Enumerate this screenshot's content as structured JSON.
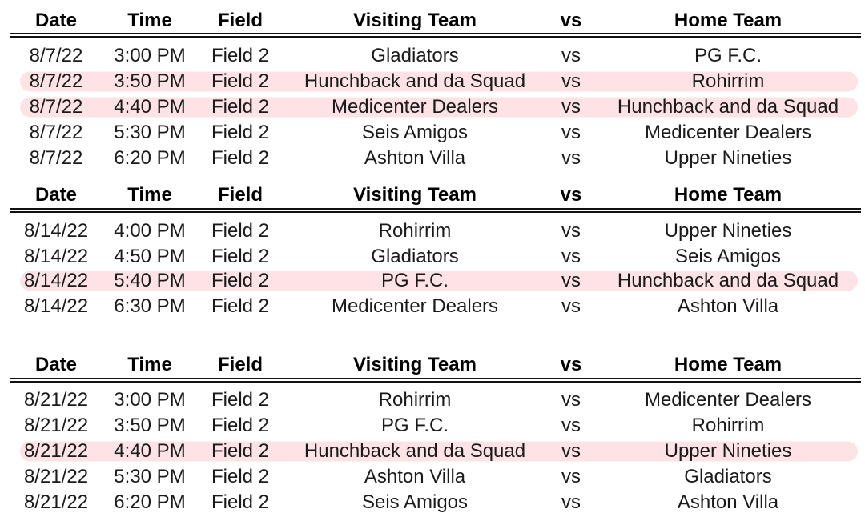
{
  "columns": [
    "Date",
    "Time",
    "Field",
    "Visiting Team",
    "vs",
    "Home Team"
  ],
  "highlight_color": "#fde3e5",
  "sections": [
    {
      "rows": [
        {
          "date": "8/7/22",
          "time": "3:00 PM",
          "field": "Field 2",
          "visiting": "Gladiators",
          "vs": "vs",
          "home": "PG F.C.",
          "highlighted": false
        },
        {
          "date": "8/7/22",
          "time": "3:50 PM",
          "field": "Field 2",
          "visiting": "Hunchback and da Squad",
          "vs": "vs",
          "home": "Rohirrim",
          "highlighted": true
        },
        {
          "date": "8/7/22",
          "time": "4:40 PM",
          "field": "Field 2",
          "visiting": "Medicenter Dealers",
          "vs": "vs",
          "home": "Hunchback and da Squad",
          "highlighted": true
        },
        {
          "date": "8/7/22",
          "time": "5:30 PM",
          "field": "Field 2",
          "visiting": "Seis Amigos",
          "vs": "vs",
          "home": "Medicenter Dealers",
          "highlighted": false
        },
        {
          "date": "8/7/22",
          "time": "6:20 PM",
          "field": "Field 2",
          "visiting": "Ashton Villa",
          "vs": "vs",
          "home": "Upper Nineties",
          "highlighted": false
        }
      ]
    },
    {
      "rows": [
        {
          "date": "8/14/22",
          "time": "4:00 PM",
          "field": "Field 2",
          "visiting": "Rohirrim",
          "vs": "vs",
          "home": "Upper Nineties",
          "highlighted": false
        },
        {
          "date": "8/14/22",
          "time": "4:50 PM",
          "field": "Field 2",
          "visiting": "Gladiators",
          "vs": "vs",
          "home": "Seis Amigos",
          "highlighted": false
        },
        {
          "date": "8/14/22",
          "time": "5:40 PM",
          "field": "Field 2",
          "visiting": "PG F.C.",
          "vs": "vs",
          "home": "Hunchback and da Squad",
          "highlighted": true
        },
        {
          "date": "8/14/22",
          "time": "6:30 PM",
          "field": "Field 2",
          "visiting": "Medicenter Dealers",
          "vs": "vs",
          "home": "Ashton Villa",
          "highlighted": false
        }
      ]
    },
    {
      "rows": [
        {
          "date": "8/21/22",
          "time": "3:00 PM",
          "field": "Field 2",
          "visiting": "Rohirrim",
          "vs": "vs",
          "home": "Medicenter Dealers",
          "highlighted": false
        },
        {
          "date": "8/21/22",
          "time": "3:50 PM",
          "field": "Field 2",
          "visiting": "PG F.C.",
          "vs": "vs",
          "home": "Rohirrim",
          "highlighted": false
        },
        {
          "date": "8/21/22",
          "time": "4:40 PM",
          "field": "Field 2",
          "visiting": "Hunchback and da Squad",
          "vs": "vs",
          "home": "Upper Nineties",
          "highlighted": true
        },
        {
          "date": "8/21/22",
          "time": "5:30 PM",
          "field": "Field 2",
          "visiting": "Ashton Villa",
          "vs": "vs",
          "home": "Gladiators",
          "highlighted": false
        },
        {
          "date": "8/21/22",
          "time": "6:20 PM",
          "field": "Field 2",
          "visiting": "Seis Amigos",
          "vs": "vs",
          "home": "Ashton Villa",
          "highlighted": false
        }
      ]
    }
  ]
}
